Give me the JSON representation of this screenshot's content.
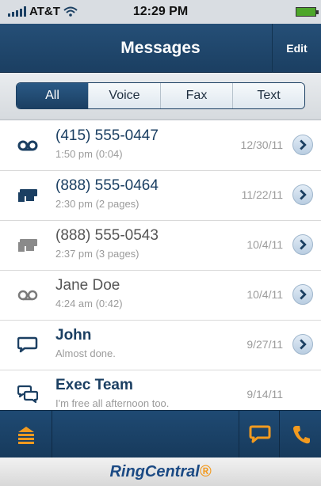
{
  "status": {
    "carrier": "AT&T",
    "time": "12:29 PM"
  },
  "nav": {
    "title": "Messages",
    "edit": "Edit"
  },
  "filters": [
    "All",
    "Voice",
    "Fax",
    "Text"
  ],
  "messages": [
    {
      "name": "(415) 555-0447",
      "sub": "1:50 pm (0:04)",
      "date": "12/30/11",
      "icon": "voicemail-icon"
    },
    {
      "name": "(888) 555-0464",
      "sub": "2:30 pm (2 pages)",
      "date": "11/22/11",
      "icon": "fax-icon"
    },
    {
      "name": "(888) 555-0543",
      "sub": "2:37 pm (3 pages)",
      "date": "10/4/11",
      "icon": "fax-icon"
    },
    {
      "name": "Jane Doe",
      "sub": "4:24 am (0:42)",
      "date": "10/4/11",
      "icon": "voicemail-icon"
    },
    {
      "name": "John",
      "sub": "Almost done.",
      "date": "9/27/11",
      "icon": "chat-bubble-icon"
    },
    {
      "name": "Exec Team",
      "sub": "I'm free all afternoon too.",
      "date": "9/14/11",
      "icon": "group-chat-icon"
    }
  ],
  "brand": {
    "part1": "RingCentral",
    "mark": "®"
  },
  "colors": {
    "navy": "#1b3f62",
    "orange": "#f29a1f",
    "link": "#1b3f62"
  }
}
